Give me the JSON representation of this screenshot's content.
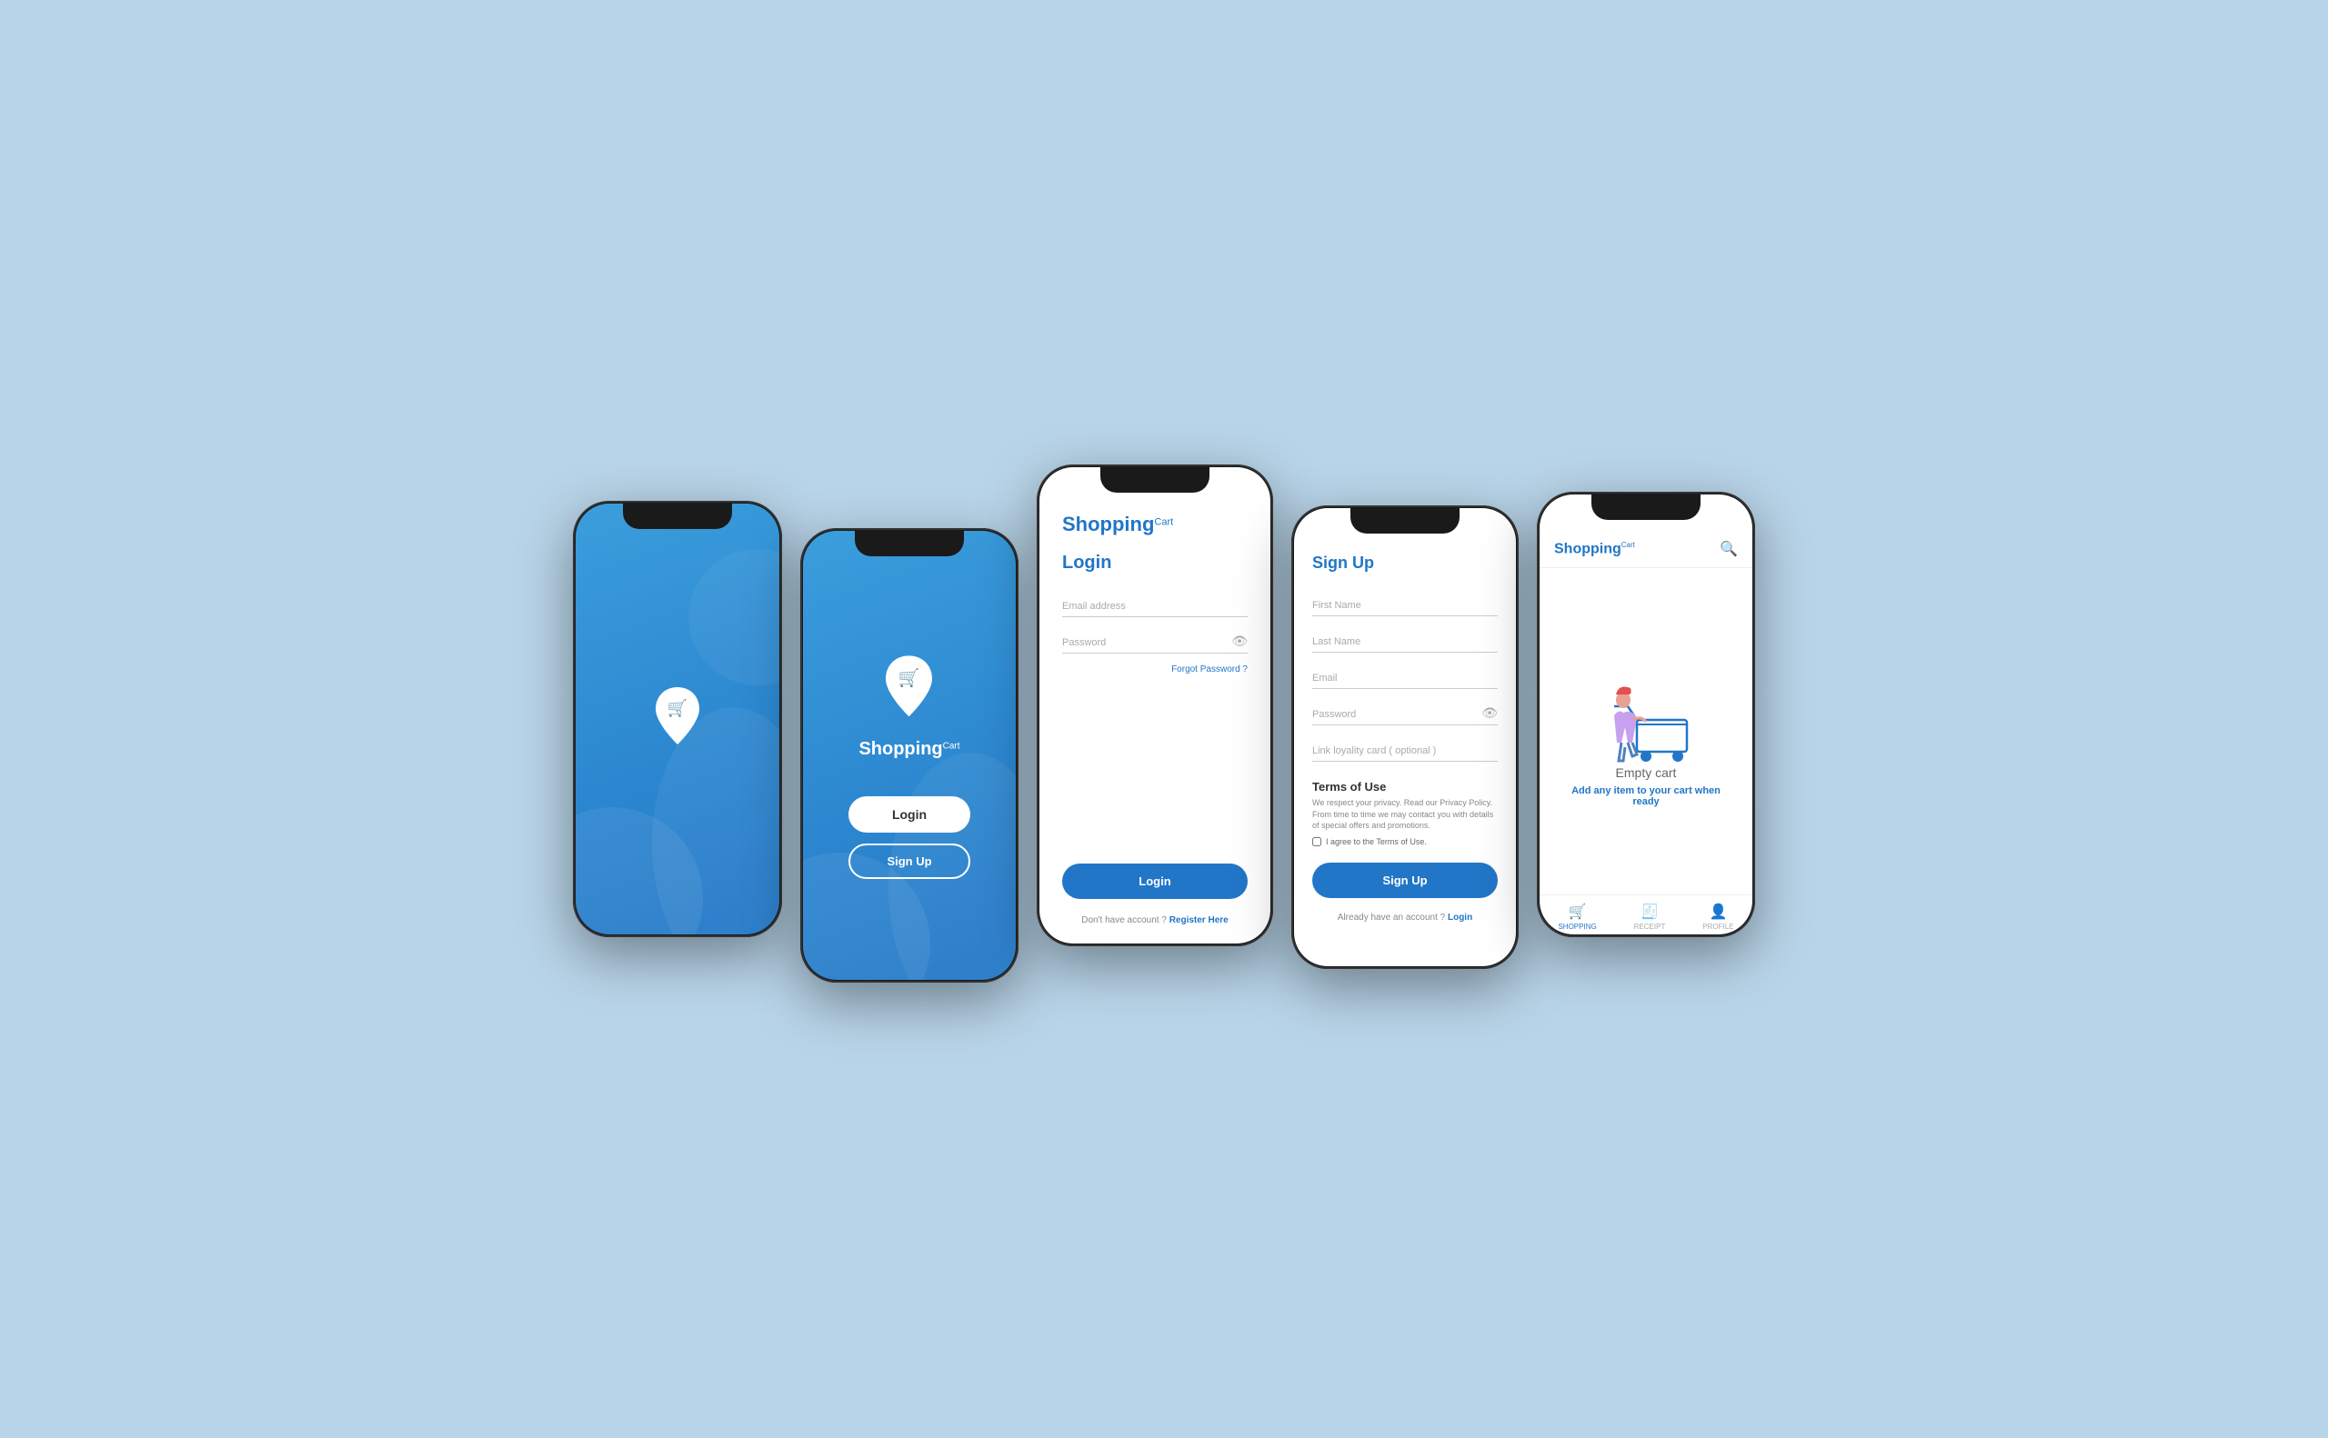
{
  "app": {
    "name": "Shopping",
    "superscript": "Cart"
  },
  "phone1": {
    "type": "splash"
  },
  "phone2": {
    "type": "welcome",
    "login_button": "Login",
    "signup_button": "Sign Up"
  },
  "phone3": {
    "type": "login",
    "title": "Login",
    "email_placeholder": "Email address",
    "password_placeholder": "Password",
    "forgot_label": "Forgot Password ?",
    "login_button": "Login",
    "no_account_text": "Don't have account ?",
    "register_link": "Register Here"
  },
  "phone4": {
    "type": "signup",
    "title": "Sign Up",
    "firstname_placeholder": "First Name",
    "lastname_placeholder": "Last Name",
    "email_placeholder": "Email",
    "password_placeholder": "Password",
    "loyalty_placeholder": "Link loyality card ( optional )",
    "terms_title": "Terms of Use",
    "terms_text": "We respect your privacy. Read our Privacy Policy. From time to time we may contact you with details of special offers and promotions.",
    "terms_agree": "I agree to the Terms of Use.",
    "signup_button": "Sign Up",
    "have_account_text": "Already have an account ?",
    "login_link": "Login"
  },
  "phone5": {
    "type": "empty_cart",
    "empty_title": "Empty cart",
    "empty_subtitle": "Add any item to your cart when ready",
    "nav_shopping": "SHOPPING",
    "nav_receipt": "RECEIPT",
    "nav_profile": "PROFILE"
  }
}
